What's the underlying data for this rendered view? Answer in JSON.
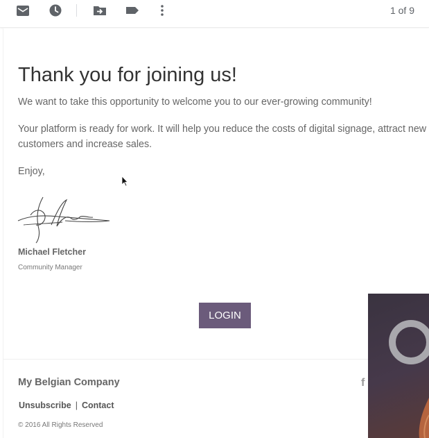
{
  "toolbar": {
    "icons": [
      "mark-unread-icon",
      "snooze-icon",
      "move-to-icon",
      "label-icon",
      "more-options-icon"
    ],
    "pager": "1 of 9"
  },
  "email": {
    "title": "Thank you for joining us!",
    "paragraph1": "We want to take this opportunity to welcome you to our ever-growing community!",
    "paragraph2": "Your platform is ready for work. It will help you reduce the costs of digital signage, attract new customers and increase sales.",
    "closing": "Enjoy,",
    "sender_name": "Michael Fletcher",
    "sender_role": "Community Manager",
    "login_label": "LOGIN"
  },
  "footer": {
    "company": "My Belgian Company",
    "unsubscribe": "Unsubscribe",
    "separator": "|",
    "contact": "Contact",
    "copyright": "© 2016 All Rights Reserved",
    "social_icon": "f"
  },
  "colors": {
    "button": "#6b5b7b",
    "title": "#333333",
    "body_text": "#666666"
  }
}
